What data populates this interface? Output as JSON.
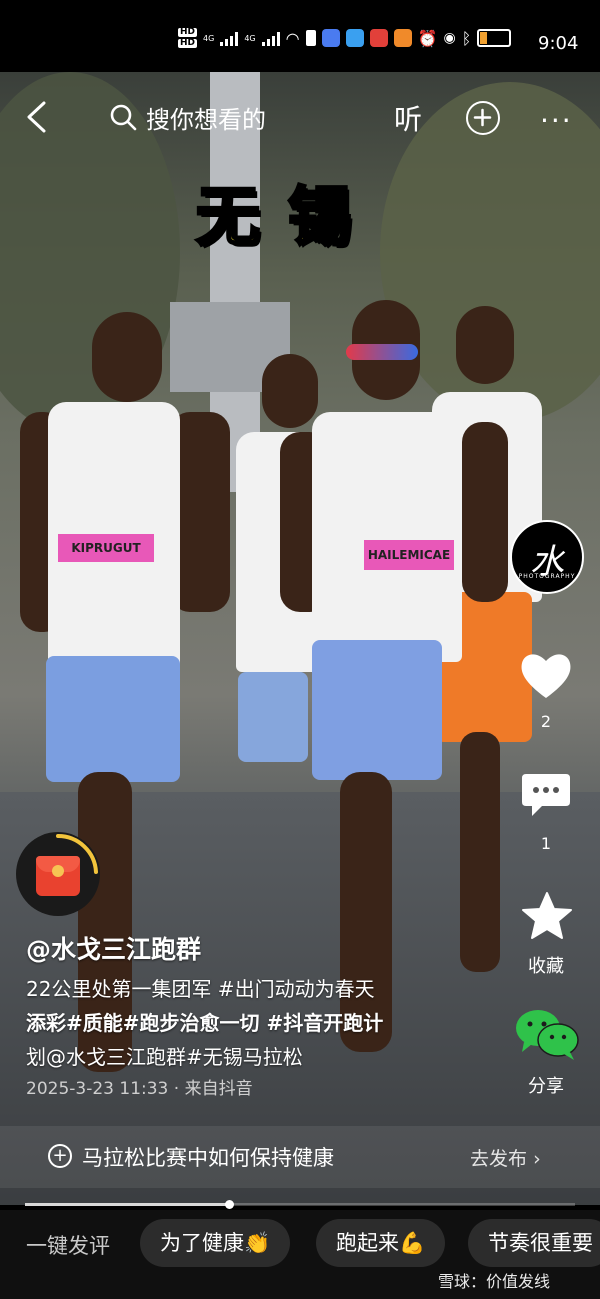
{
  "status_bar": {
    "time": "9:04",
    "hd1": "HD",
    "hd2": "HD",
    "net1": "4G",
    "net2": "4G"
  },
  "top_bar": {
    "search_placeholder": "搜你想看的",
    "listen_label": "听"
  },
  "overlay_title": "无锡",
  "video": {
    "bib1": "KIPRUGUT",
    "bib2": "HAILEMICAE"
  },
  "right_rail": {
    "avatar_mark": "水",
    "avatar_sub": "PHOTOGRAPHY",
    "like_count": "2",
    "comment_count": "1",
    "favorite_label": "收藏",
    "share_label": "分享"
  },
  "post": {
    "username": "@水戈三江跑群",
    "caption_lines": [
      "22公里处第一集团军 #出门动动为春天",
      "添彩#质能#跑步治愈一切 #抖音开跑计",
      "划@水戈三江跑群#无锡马拉松"
    ],
    "meta": "2025-3-23 11:33 · 来自抖音"
  },
  "topic_bar": {
    "text": "马拉松比赛中如何保持健康",
    "action": "去发布"
  },
  "playback": {
    "progress_fraction": 0.37
  },
  "bottom_bar": {
    "quick_label": "一键发评",
    "chips": [
      "为了健康👏",
      "跑起来💪",
      "节奏很重要"
    ]
  },
  "watermark": "雪球：价值发线",
  "colors": {
    "title_yellow": "#f8e63a",
    "like_white": "#ffffff",
    "wechat_green": "#2fc24a",
    "redpacket": "#e9422f"
  }
}
